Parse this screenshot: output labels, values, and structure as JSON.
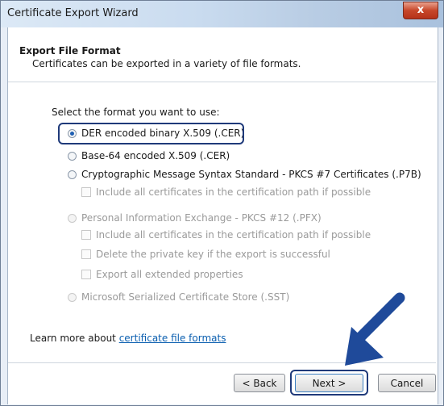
{
  "window": {
    "title": "Certificate Export Wizard",
    "close_glyph": "x"
  },
  "header": {
    "title": "Export File Format",
    "subtitle": "Certificates can be exported in a variety of file formats."
  },
  "prompt": "Select the format you want to use:",
  "options": [
    {
      "label": "DER encoded binary X.509 (.CER)",
      "selected": true,
      "enabled": true
    },
    {
      "label": "Base-64 encoded X.509 (.CER)",
      "selected": false,
      "enabled": true
    },
    {
      "label": "Cryptographic Message Syntax Standard - PKCS #7 Certificates (.P7B)",
      "selected": false,
      "enabled": true
    },
    {
      "label": "Personal Information Exchange - PKCS #12 (.PFX)",
      "selected": false,
      "enabled": false
    },
    {
      "label": "Microsoft Serialized Certificate Store (.SST)",
      "selected": false,
      "enabled": false
    }
  ],
  "checkboxes": [
    {
      "label": "Include all certificates in the certification path if possible",
      "checked": false,
      "enabled": false
    },
    {
      "label": "Include all certificates in the certification path if possible",
      "checked": false,
      "enabled": false
    },
    {
      "label": "Delete the private key if the export is successful",
      "checked": false,
      "enabled": false
    },
    {
      "label": "Export all extended properties",
      "checked": false,
      "enabled": false
    }
  ],
  "learn_more": {
    "prefix": "Learn more about ",
    "link": "certificate file formats"
  },
  "buttons": {
    "back": "< Back",
    "next": "Next >",
    "cancel": "Cancel"
  },
  "colors": {
    "highlight": "#1f3a7a",
    "arrow": "#1f4a9a",
    "link": "#0b5fb0"
  }
}
